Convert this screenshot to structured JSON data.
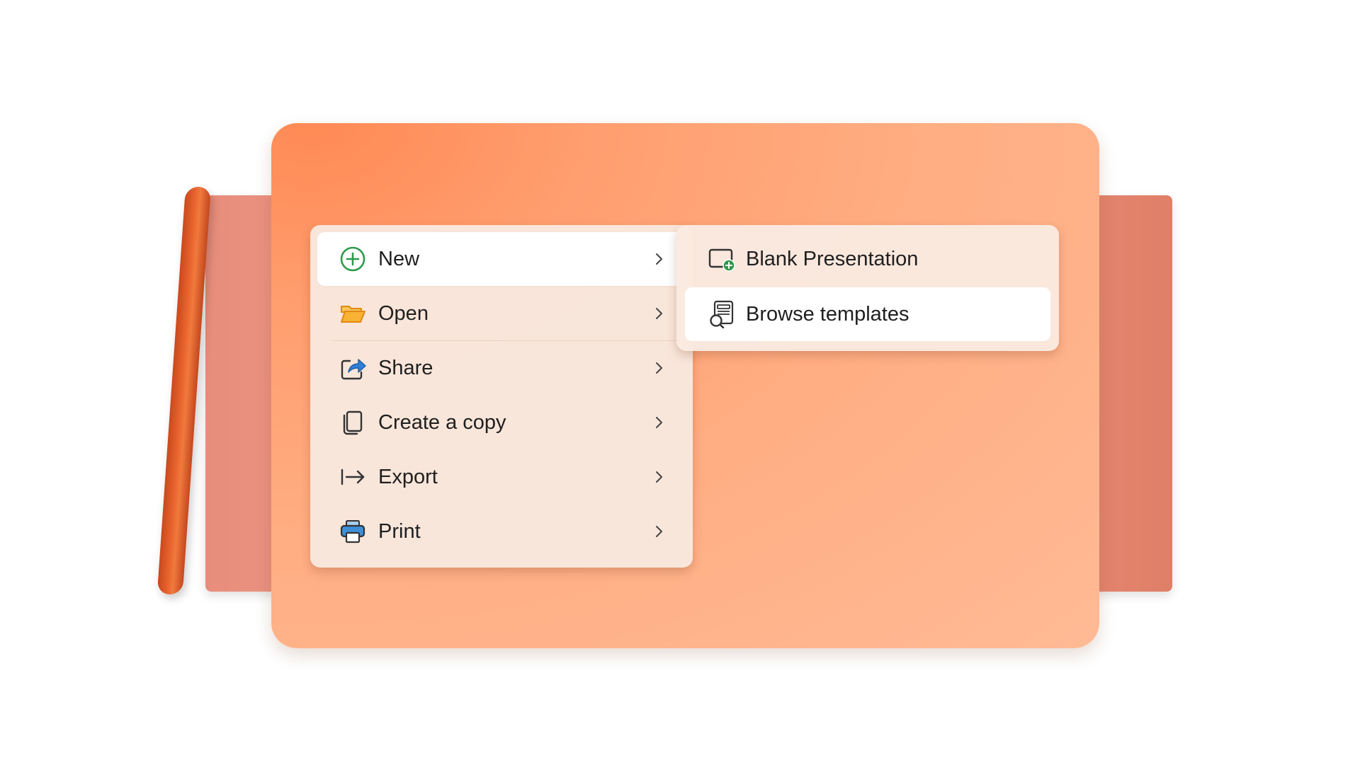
{
  "menu": {
    "items": [
      {
        "label": "New",
        "icon": "plus-circle-icon",
        "active": true
      },
      {
        "label": "Open",
        "icon": "folder-open-icon",
        "active": false
      },
      {
        "label": "Share",
        "icon": "share-arrow-icon",
        "active": false
      },
      {
        "label": "Create a copy",
        "icon": "copy-icon",
        "active": false
      },
      {
        "label": "Export",
        "icon": "export-arrow-icon",
        "active": false
      },
      {
        "label": "Print",
        "icon": "printer-icon",
        "active": false
      }
    ]
  },
  "submenu": {
    "items": [
      {
        "label": "Blank Presentation",
        "icon": "blank-presentation-icon",
        "active": false
      },
      {
        "label": "Browse templates",
        "icon": "browse-templates-icon",
        "active": true
      }
    ]
  },
  "colors": {
    "board": "#ffad82",
    "back_sheet": "#ee9a87",
    "roll": "#e9642e",
    "menu_bg": "#f9e8de",
    "plus_green": "#2e9a4a",
    "folder_orange": "#f2a31c",
    "share_blue": "#2f7fd6",
    "printer_blue": "#3d8fd8"
  }
}
